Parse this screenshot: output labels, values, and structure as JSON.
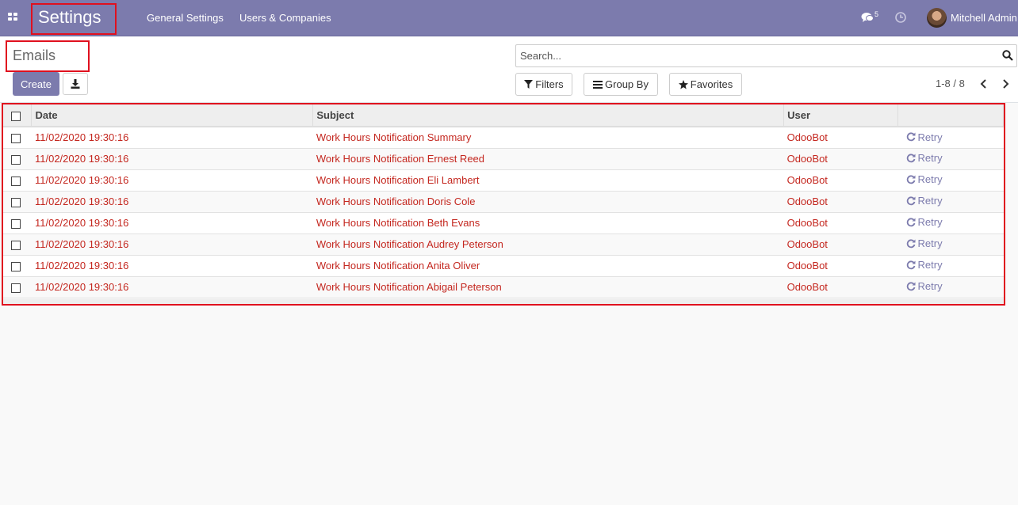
{
  "navbar": {
    "brand": "Settings",
    "menu": [
      "General Settings",
      "Users & Companies"
    ],
    "messages_badge": "5",
    "user_name": "Mitchell Admin"
  },
  "control_panel": {
    "title": "Emails",
    "create_label": "Create",
    "search_placeholder": "Search...",
    "filters_label": "Filters",
    "group_by_label": "Group By",
    "favorites_label": "Favorites",
    "pager": "1-8 / 8"
  },
  "table": {
    "columns": [
      "Date",
      "Subject",
      "User"
    ],
    "rows": [
      {
        "date": "11/02/2020 19:30:16",
        "subject": "Work Hours Notification Summary",
        "user": "OdooBot",
        "action": "Retry"
      },
      {
        "date": "11/02/2020 19:30:16",
        "subject": "Work Hours Notification Ernest Reed",
        "user": "OdooBot",
        "action": "Retry"
      },
      {
        "date": "11/02/2020 19:30:16",
        "subject": "Work Hours Notification Eli Lambert",
        "user": "OdooBot",
        "action": "Retry"
      },
      {
        "date": "11/02/2020 19:30:16",
        "subject": "Work Hours Notification Doris Cole",
        "user": "OdooBot",
        "action": "Retry"
      },
      {
        "date": "11/02/2020 19:30:16",
        "subject": "Work Hours Notification Beth Evans",
        "user": "OdooBot",
        "action": "Retry"
      },
      {
        "date": "11/02/2020 19:30:16",
        "subject": "Work Hours Notification Audrey Peterson",
        "user": "OdooBot",
        "action": "Retry"
      },
      {
        "date": "11/02/2020 19:30:16",
        "subject": "Work Hours Notification Anita Oliver",
        "user": "OdooBot",
        "action": "Retry"
      },
      {
        "date": "11/02/2020 19:30:16",
        "subject": "Work Hours Notification Abigail Peterson",
        "user": "OdooBot",
        "action": "Retry"
      }
    ]
  },
  "colors": {
    "brand": "#7c7bad",
    "row_text": "#c4271f",
    "highlight": "#e0101e"
  }
}
